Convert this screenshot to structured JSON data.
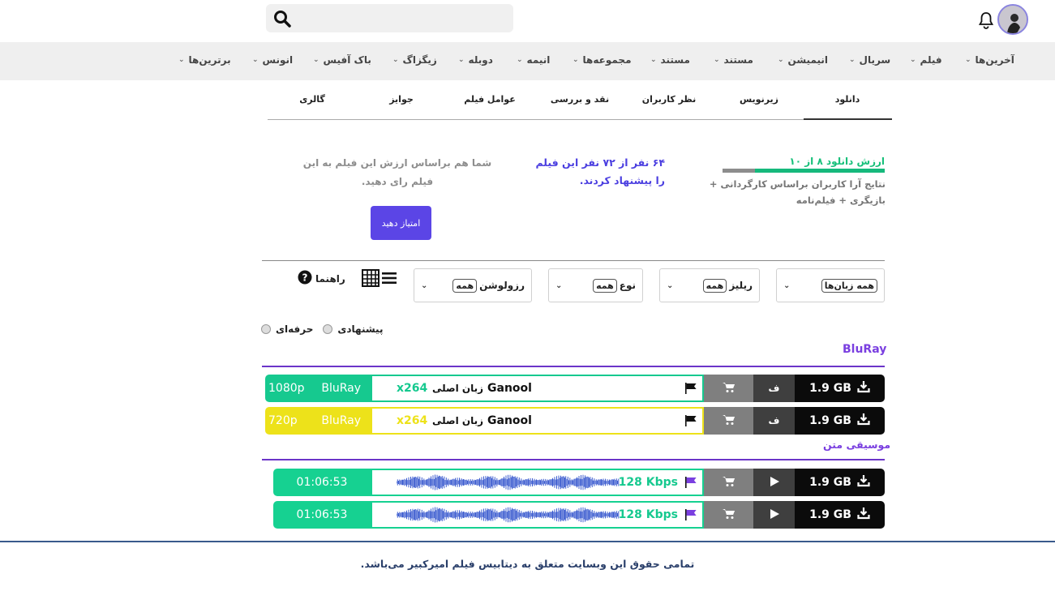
{
  "header": {
    "search_placeholder": ""
  },
  "nav": [
    "آخرین‌ها",
    "فیلم",
    "سریال",
    "انیمیشن",
    "مستند",
    "مستند",
    "مجموعه‌ها",
    "انیمه",
    "دوبله",
    "زیگزاگ",
    "باک آفیس",
    "انونس",
    "برترین‌ها"
  ],
  "tabs": [
    "دانلود",
    "زیرنویس",
    "نظر کاربران",
    "نقد و بررسی",
    "عوامل فیلم",
    "جوایز",
    "گالری"
  ],
  "rating": {
    "title": "ارزش دانلود ۸ از ۱۰",
    "value": 8,
    "max": 10,
    "desc": "نتایج آرا کاربران براساس کارگردانی + بازیگری + فیلم‌نامه",
    "recommend": "۶۴ نفر از ۷۲ نفر این فیلم را پیشنهاد کردند.",
    "ask": "شما هم براساس ارزش این فیلم به این فیلم رای دهید.",
    "button": "امتیاز دهید"
  },
  "filters": [
    {
      "label": "",
      "value": "همه زبان‌ها"
    },
    {
      "label": "ریلیز",
      "value": "همه"
    },
    {
      "label": "نوع",
      "value": "همه"
    },
    {
      "label": "رزولوشن",
      "value": "همه"
    }
  ],
  "help_label": "راهنما",
  "radios": [
    "پیشنهادی",
    "حرفه‌ای"
  ],
  "sections": {
    "bluray": "BluRay",
    "music": "موسیقی متن"
  },
  "video_rows": [
    {
      "size": "1.9 GB",
      "sub": "ف",
      "group": "Ganool",
      "lang": "زبان اصلی",
      "codec": "x264",
      "source": "BluRay",
      "res": "1080p",
      "color": "#16c98f"
    },
    {
      "size": "1.9 GB",
      "sub": "ف",
      "group": "Ganool",
      "lang": "زبان اصلی",
      "codec": "x264",
      "source": "BluRay",
      "res": "720p",
      "color": "#ede21a"
    }
  ],
  "music_rows": [
    {
      "size": "1.9 GB",
      "bitrate": "128 Kbps",
      "duration": "01:06:53",
      "color": "#16d191"
    },
    {
      "size": "1.9 GB",
      "bitrate": "128 Kbps",
      "duration": "01:06:53",
      "color": "#16d191"
    }
  ],
  "footer": "تمامی حقوق این وبسایت متعلق به دیتابیس فیلم امیرکبیر می‌باشد."
}
